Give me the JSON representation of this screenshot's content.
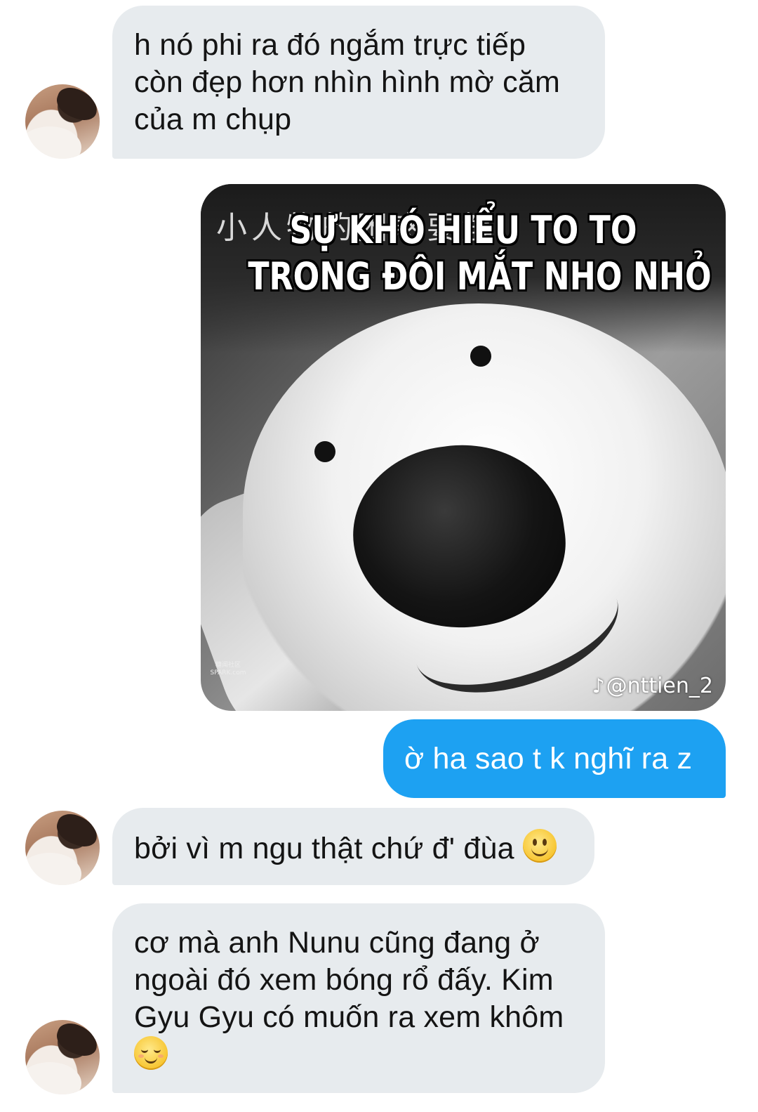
{
  "messages": [
    {
      "id": "m1",
      "direction": "incoming",
      "lines": [
        "h nó phi ra đó ngắm trực tiếp",
        "còn đẹp hơn nhìn hình mờ căm",
        "của m chụp"
      ]
    },
    {
      "id": "m2",
      "direction": "outgoing",
      "type": "image",
      "image": {
        "description_icon": "meme-image",
        "background_chinese_text": "小人物的困惑要解",
        "caption_lines": [
          "SỰ KHÓ HIỂU TO TO",
          "TRONG ĐÔI MẮT NHO NHỎ"
        ],
        "watermark": "@nttien_2",
        "watermark_icon": "tiktok-icon",
        "corner_logo_lines": [
          "糖闻社区",
          "SPARK.com"
        ]
      }
    },
    {
      "id": "m3",
      "direction": "outgoing",
      "lines": [
        "ờ ha sao t k nghĩ ra z"
      ]
    },
    {
      "id": "m4",
      "direction": "incoming",
      "lines": [
        "bởi vì m ngu thật chứ đ' đùa"
      ],
      "trailing_emoji": "slightly-smiling-face-emoji"
    },
    {
      "id": "m5",
      "direction": "incoming",
      "lines": [
        "cơ mà anh Nunu cũng đang ở",
        "ngoài đó xem bóng rổ đấy. Kim",
        "Gyu Gyu có muốn ra xem khôm"
      ],
      "trailing_emoji": "relieved-face-emoji"
    }
  ],
  "colors": {
    "incoming_bubble": "#e7ebee",
    "outgoing_bubble": "#1da1f2",
    "incoming_text": "#141414",
    "outgoing_text": "#ffffff"
  }
}
